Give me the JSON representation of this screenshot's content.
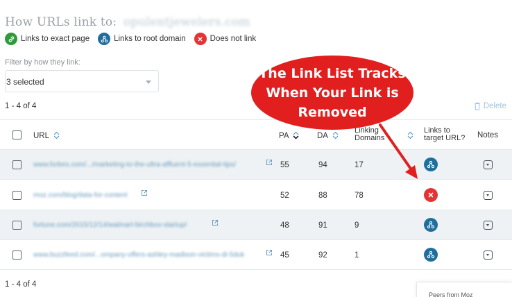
{
  "header": {
    "title": "How URLs link to:",
    "domain": "opulentjewelers.com"
  },
  "legend": [
    {
      "label": "Links to exact page",
      "icon": "link-icon",
      "color": "#2e9a3a"
    },
    {
      "label": "Links to root domain",
      "icon": "sitemap-icon",
      "color": "#1f6f9e"
    },
    {
      "label": "Does not link",
      "icon": "x-icon",
      "color": "#e23535"
    }
  ],
  "filter": {
    "label": "Filter by how they link:",
    "selected": "3 selected"
  },
  "pagination": {
    "top": "1 - 4 of 4",
    "bottom": "1 - 4 of 4"
  },
  "toolbar": {
    "delete_label": "Delete"
  },
  "table": {
    "headers": {
      "url": "URL",
      "pa": "PA",
      "da": "DA",
      "linking_domains_1": "Linking",
      "linking_domains_2": "Domains",
      "links_to_target_1": "Links to",
      "links_to_target_2": "target URL?",
      "notes": "Notes"
    },
    "rows": [
      {
        "url": "www.forbes.com/.../marketing-to-the-ultra-affluent-5-essential-tips/",
        "pa": "55",
        "da": "94",
        "linking_domains": "17",
        "status": "root-domain"
      },
      {
        "url": "moz.com/blog/data-for-content",
        "pa": "52",
        "da": "88",
        "linking_domains": "78",
        "status": "does-not-link"
      },
      {
        "url": "fortune.com/2015/12/14/walmart-birchbox-startup/",
        "pa": "48",
        "da": "91",
        "linking_domains": "9",
        "status": "root-domain"
      },
      {
        "url": "www.buzzfeed.com/...ompany-offers-ashley-madison-victims-di-5duk",
        "pa": "45",
        "da": "92",
        "linking_domains": "1",
        "status": "root-domain"
      }
    ]
  },
  "callout": {
    "line1": "The Link List Tracks",
    "line2": "When Your Link is",
    "line3": "Removed",
    "color": "#e21f1f"
  },
  "popup": {
    "text": "Peers from Moz"
  },
  "colors": {
    "link_blue": "#1f6f9e",
    "link_green": "#2e9a3a",
    "does_not_link_red": "#e23535"
  }
}
